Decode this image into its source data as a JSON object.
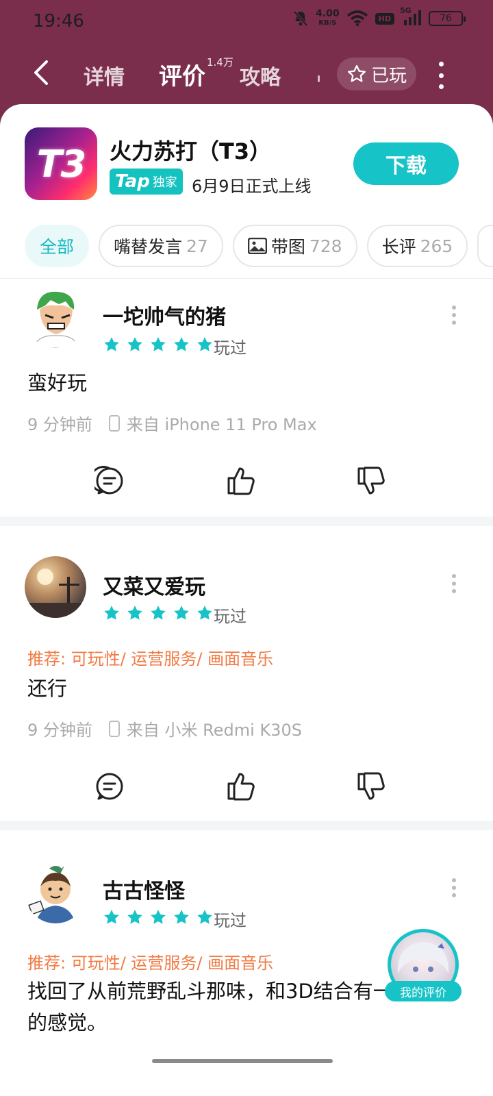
{
  "status": {
    "time": "19:46",
    "speed_value": "4.00",
    "speed_unit": "KB/S",
    "hd": "HD",
    "network": "5G",
    "battery": "76"
  },
  "nav": {
    "tabs": [
      "详情",
      "评价",
      "攻略"
    ],
    "review_count": "1.4万",
    "played_label": "已玩"
  },
  "game": {
    "icon_text": "T3",
    "title": "火力苏打（T3）",
    "badge_brand": "Tap",
    "badge_text": "独家",
    "release": "6月9日正式上线",
    "download": "下载"
  },
  "filters": [
    {
      "label": "全部",
      "count": ""
    },
    {
      "label": "嘴替发言",
      "count": "27"
    },
    {
      "label": "带图",
      "count": "728"
    },
    {
      "label": "长评",
      "count": "265"
    }
  ],
  "reviews": [
    {
      "user": "一坨帅气的猪",
      "rating": 5,
      "played": "玩过",
      "recommend": "",
      "content": "蛮好玩",
      "time": "9 分钟前",
      "device": "来自 iPhone 11 Pro Max"
    },
    {
      "user": "又菜又爱玩",
      "rating": 5,
      "played": "玩过",
      "recommend": "推荐: 可玩性/ 运营服务/ 画面音乐",
      "content": "还行",
      "time": "9 分钟前",
      "device": "来自 小米 Redmi K30S"
    },
    {
      "user": "古古怪怪",
      "rating": 5,
      "played": "玩过",
      "recommend": "推荐: 可玩性/ 运营服务/ 画面音乐",
      "content": "找回了从前荒野乱斗那味，和3D结合有一种奇妙的感觉。",
      "time": "",
      "device": ""
    }
  ],
  "my_review": "我的评价",
  "colors": {
    "header_bg": "#7b2d4c",
    "accent": "#16c3c7",
    "recommend": "#f27a43"
  }
}
